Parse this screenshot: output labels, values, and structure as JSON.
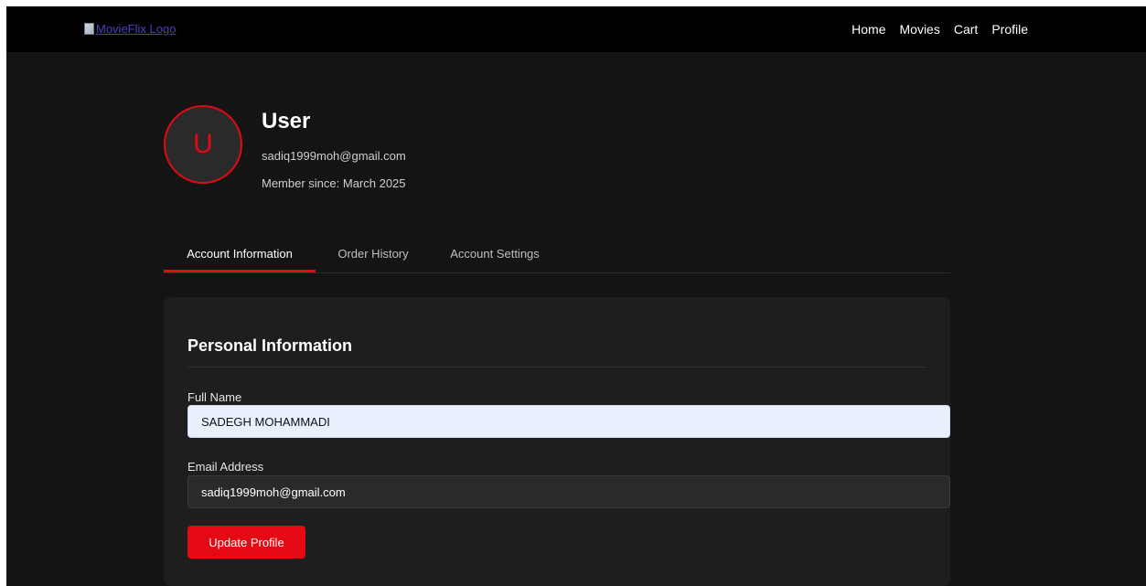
{
  "header": {
    "logo_alt": "MovieFlix Logo",
    "nav": [
      "Home",
      "Movies",
      "Cart",
      "Profile"
    ]
  },
  "profile": {
    "avatar_initial": "U",
    "name": "User",
    "email": "sadiq1999moh@gmail.com",
    "member_since": "Member since: March 2025"
  },
  "tabs": [
    {
      "label": "Account Information",
      "active": true
    },
    {
      "label": "Order History",
      "active": false
    },
    {
      "label": "Account Settings",
      "active": false
    }
  ],
  "personal_info": {
    "title": "Personal Information",
    "full_name_label": "Full Name",
    "full_name_value": "SADEGH MOHAMMADI",
    "email_label": "Email Address",
    "email_value": "sadiq1999moh@gmail.com",
    "update_button": "Update Profile"
  },
  "colors": {
    "accent": "#e50914",
    "background": "#141414",
    "card": "#1e1e1e",
    "topbar": "#000000"
  }
}
